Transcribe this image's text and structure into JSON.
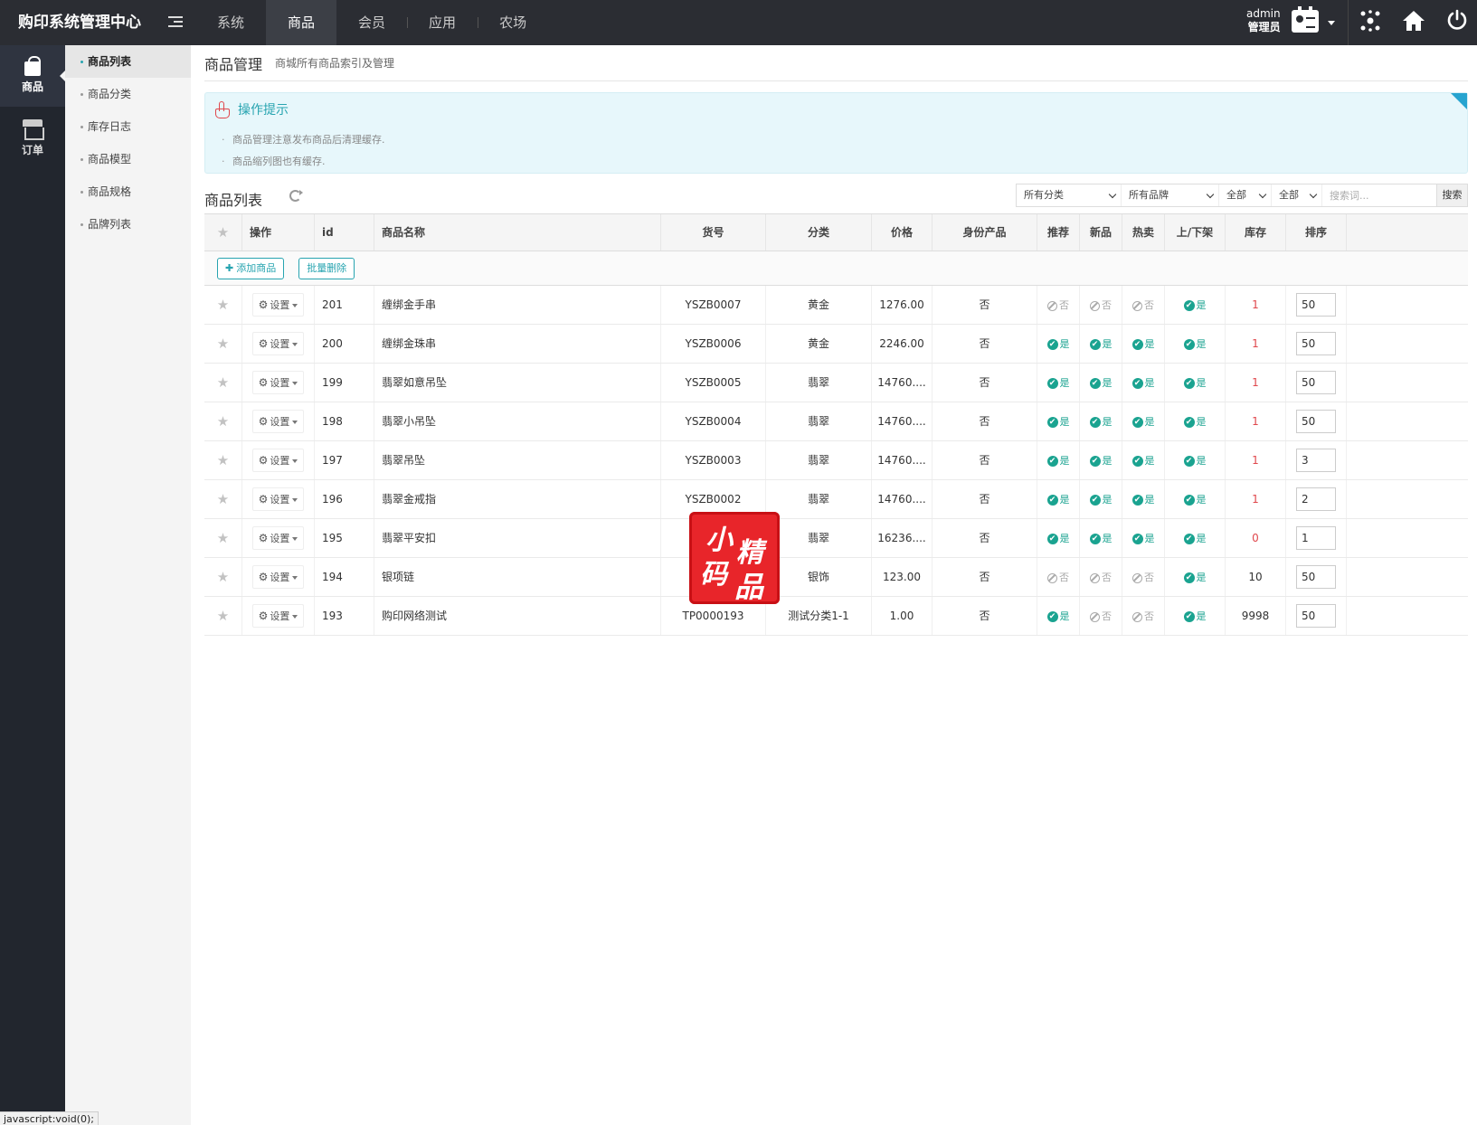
{
  "app": {
    "title": "购印系统管理中心"
  },
  "topnav": [
    {
      "label": "系统",
      "active": false
    },
    {
      "label": "商品",
      "active": true
    },
    {
      "label": "会员",
      "active": false
    },
    {
      "label": "应用",
      "active": false
    },
    {
      "label": "农场",
      "active": false
    }
  ],
  "user": {
    "name": "admin",
    "role": "管理员"
  },
  "rail": [
    {
      "label": "商品",
      "icon": "bag-icon",
      "active": true
    },
    {
      "label": "订单",
      "icon": "store-icon",
      "active": false
    }
  ],
  "submenu": [
    {
      "label": "商品列表",
      "active": true
    },
    {
      "label": "商品分类",
      "active": false
    },
    {
      "label": "库存日志",
      "active": false
    },
    {
      "label": "商品模型",
      "active": false
    },
    {
      "label": "商品规格",
      "active": false
    },
    {
      "label": "品牌列表",
      "active": false
    }
  ],
  "page": {
    "title": "商品管理",
    "subtitle": "商城所有商品索引及管理"
  },
  "tips": {
    "title": "操作提示",
    "items": [
      "商品管理注意发布商品后清理缓存.",
      "商品缩列图也有缓存."
    ]
  },
  "list": {
    "title": "商品列表"
  },
  "filters": {
    "category": "所有分类",
    "brand": "所有品牌",
    "filter_a": "全部",
    "filter_b": "全部",
    "search_placeholder": "搜索词...",
    "search_button": "搜索"
  },
  "table": {
    "headers": [
      "操作",
      "id",
      "商品名称",
      "货号",
      "分类",
      "价格",
      "身份产品",
      "推荐",
      "新品",
      "热卖",
      "上/下架",
      "库存",
      "排序"
    ],
    "add_button": "添加商品",
    "batch_delete_button": "批量删除",
    "settings_label": "设置",
    "yes_label": "是",
    "no_label": "否",
    "rows": [
      {
        "id": "201",
        "name": "缠绑金手串",
        "sku": "YSZB0007",
        "category": "黄金",
        "price": "1276.00",
        "identity": "否",
        "recommend": false,
        "new": false,
        "hot": false,
        "on_sale": true,
        "stock": "1",
        "stock_red": true,
        "sort": "50"
      },
      {
        "id": "200",
        "name": "缠绑金珠串",
        "sku": "YSZB0006",
        "category": "黄金",
        "price": "2246.00",
        "identity": "否",
        "recommend": true,
        "new": true,
        "hot": true,
        "on_sale": true,
        "stock": "1",
        "stock_red": true,
        "sort": "50"
      },
      {
        "id": "199",
        "name": "翡翠如意吊坠",
        "sku": "YSZB0005",
        "category": "翡翠",
        "price": "14760....",
        "identity": "否",
        "recommend": true,
        "new": true,
        "hot": true,
        "on_sale": true,
        "stock": "1",
        "stock_red": true,
        "sort": "50"
      },
      {
        "id": "198",
        "name": "翡翠小吊坠",
        "sku": "YSZB0004",
        "category": "翡翠",
        "price": "14760....",
        "identity": "否",
        "recommend": true,
        "new": true,
        "hot": true,
        "on_sale": true,
        "stock": "1",
        "stock_red": true,
        "sort": "50"
      },
      {
        "id": "197",
        "name": "翡翠吊坠",
        "sku": "YSZB0003",
        "category": "翡翠",
        "price": "14760....",
        "identity": "否",
        "recommend": true,
        "new": true,
        "hot": true,
        "on_sale": true,
        "stock": "1",
        "stock_red": true,
        "sort": "3"
      },
      {
        "id": "196",
        "name": "翡翠金戒指",
        "sku": "YSZB0002",
        "category": "翡翠",
        "price": "14760....",
        "identity": "否",
        "recommend": true,
        "new": true,
        "hot": true,
        "on_sale": true,
        "stock": "1",
        "stock_red": true,
        "sort": "2"
      },
      {
        "id": "195",
        "name": "翡翠平安扣",
        "sku": "",
        "category": "翡翠",
        "price": "16236....",
        "identity": "否",
        "recommend": true,
        "new": true,
        "hot": true,
        "on_sale": true,
        "stock": "0",
        "stock_red": true,
        "sort": "1"
      },
      {
        "id": "194",
        "name": "银项链",
        "sku": "",
        "category": "银饰",
        "price": "123.00",
        "identity": "否",
        "recommend": false,
        "new": false,
        "hot": false,
        "on_sale": true,
        "stock": "10",
        "stock_red": false,
        "sort": "50"
      },
      {
        "id": "193",
        "name": "购印网络测试",
        "sku": "TP0000193",
        "category": "测试分类1-1",
        "price": "1.00",
        "identity": "否",
        "recommend": true,
        "new": false,
        "hot": false,
        "on_sale": true,
        "stock": "9998",
        "stock_red": false,
        "sort": "50"
      }
    ]
  },
  "stamp": {
    "chars": [
      "小",
      "精",
      "码",
      "品"
    ],
    "color": "#e8252a"
  },
  "statusbar": {
    "text": "javascript:void(0);"
  },
  "colors": {
    "topbar": "#2b2d33",
    "accent": "#27a4b0",
    "yes": "#1aa390",
    "stock_red": "#e0474c"
  }
}
